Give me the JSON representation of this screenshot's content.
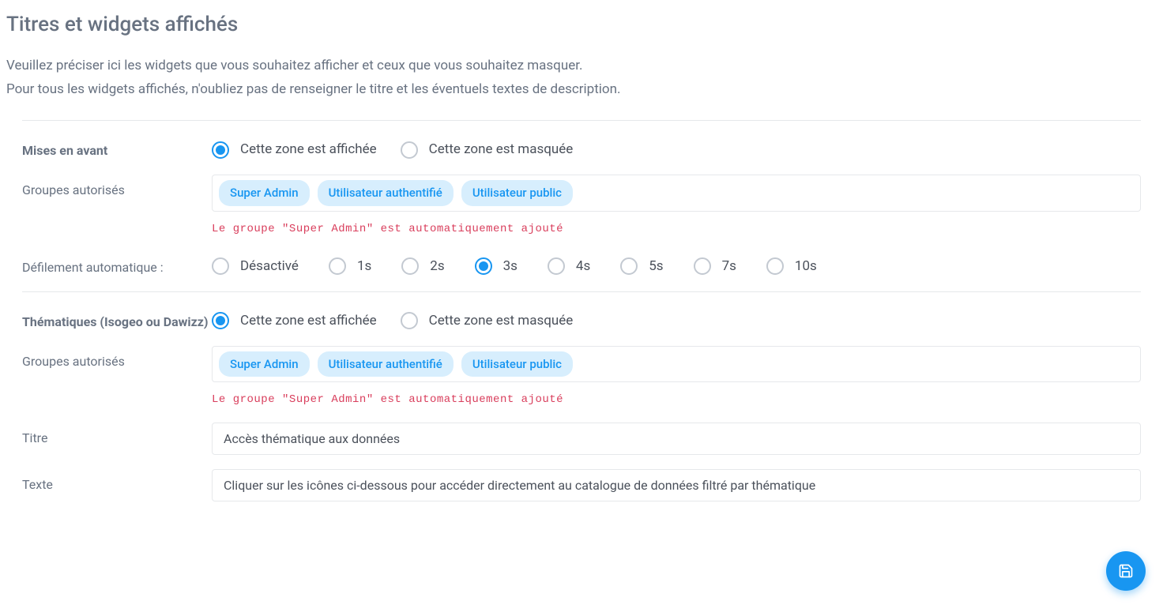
{
  "header": {
    "title": "Titres et widgets affichés",
    "desc1": "Veuillez préciser ici les widgets que vous souhaitez afficher et ceux que vous souhaitez masquer.",
    "desc2": "Pour tous les widgets affichés, n'oubliez pas de renseigner le titre et les éventuels textes de description."
  },
  "labels": {
    "zoneShown": "Cette zone est affichée",
    "zoneHidden": "Cette zone est masquée",
    "allowedGroups": "Groupes autorisés",
    "autoScroll": "Défilement automatique :",
    "titleField": "Titre",
    "textField": "Texte"
  },
  "groupsHelper": "Le groupe \"Super Admin\" est automatiquement ajouté",
  "groups": {
    "tag0": "Super Admin",
    "tag1": "Utilisateur authentifié",
    "tag2": "Utilisateur public"
  },
  "featured": {
    "heading": "Mises en avant",
    "zoneShownSelected": true,
    "scrollSelected": "3s"
  },
  "scrollOptions": {
    "o0": "Désactivé",
    "o1": "1s",
    "o2": "2s",
    "o3": "3s",
    "o4": "4s",
    "o5": "5s",
    "o6": "7s",
    "o7": "10s"
  },
  "themes": {
    "heading": "Thématiques (Isogeo ou Dawizz)",
    "zoneShownSelected": true,
    "titleValue": "Accès thématique aux données",
    "textValue": "Cliquer sur les icônes ci-dessous pour accéder directement au catalogue de données filtré par thématique"
  }
}
